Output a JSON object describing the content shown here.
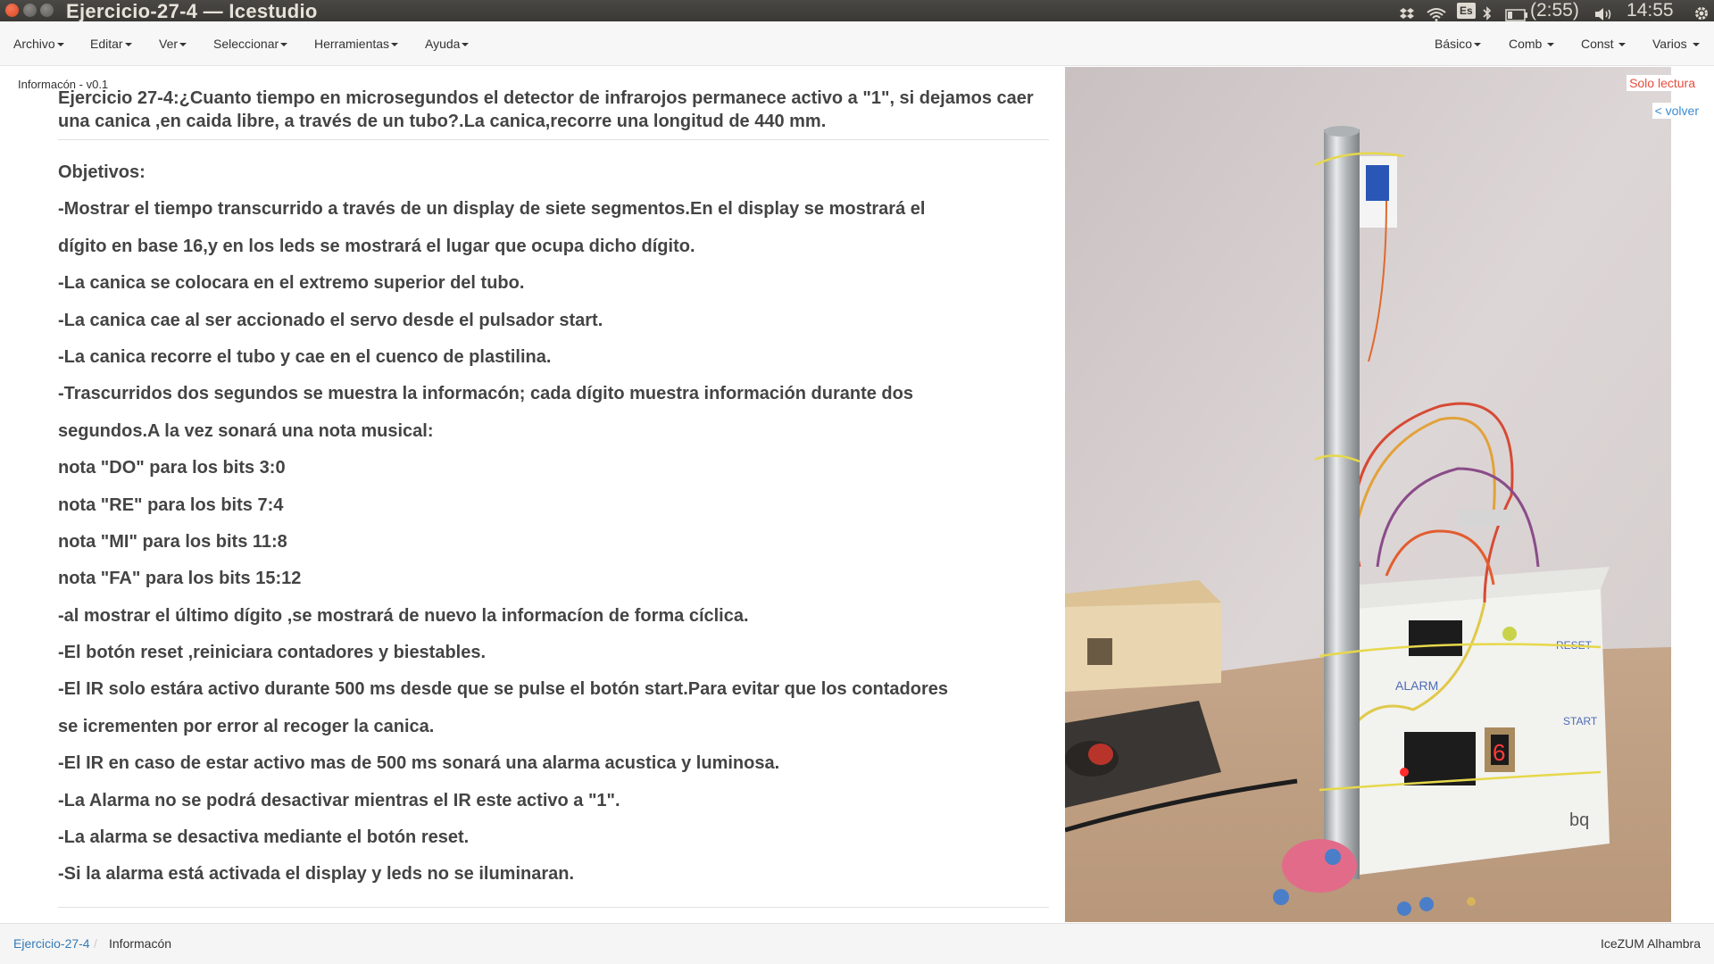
{
  "window": {
    "title": "Ejercicio-27-4 — Icestudio",
    "controls": [
      "close-icon",
      "minimize-icon",
      "maximize-icon"
    ]
  },
  "system_tray": {
    "dropbox_icon": "dropbox-icon",
    "wifi_icon": "wifi-icon",
    "keyboard_layout": "Es",
    "bluetooth_icon": "bluetooth-icon",
    "battery_text": "(2:55)",
    "volume_icon": "volume-icon",
    "clock": "14:55",
    "settings_icon": "gear-icon"
  },
  "menu": {
    "left": [
      "Archivo",
      "Editar",
      "Ver",
      "Seleccionar",
      "Herramientas",
      "Ayuda"
    ],
    "right": [
      "Básico",
      "Comb",
      "Const",
      "Varios"
    ]
  },
  "panel": {
    "label": "Informacón - v0.1",
    "readonly": "Solo lectura",
    "back": "< volver"
  },
  "document": {
    "title": "Ejercicio 27-4:¿Cuanto tiempo en microsegundos el detector de infrarojos permanece activo a \"1\", si dejamos caer una canica ,en caida libre, a través de un tubo?.La canica,recorre una longitud de 440 mm.",
    "lines": [
      "Objetivos:",
      "-Mostrar el tiempo transcurrido a través de un display de siete segmentos.En el display se mostrará el",
      "dígito en base 16,y en los leds se mostrará el lugar que ocupa dicho dígito.",
      "-La canica se colocara en el extremo superior del tubo.",
      "-La canica cae al ser accionado el servo desde el pulsador start.",
      "-La canica recorre el tubo y cae en el cuenco de plastilina.",
      "-Trascurridos dos segundos se muestra la informacón; cada dígito muestra información durante dos",
      "segundos.A la vez sonará una nota musical:",
      "nota \"DO\" para los bits 3:0",
      "nota \"RE\" para los bits 7:4",
      "nota \"MI\" para los bits 11:8",
      "nota \"FA\" para los bits 15:12",
      "-al mostrar el último dígito ,se mostrará de nuevo la informacíon de forma cíclica.",
      "-El botón reset ,reiniciara contadores y biestables.",
      "-El IR solo estára activo durante 500 ms desde que se pulse el botón start.Para evitar que los contadores",
      "se icrementen por error al recoger la canica.",
      "-El IR en caso de estar activo mas de 500 ms sonará una alarma acustica y luminosa.",
      "-La Alarma no se podrá desactivar mientras el IR este activo a \"1\".",
      "-La alarma se desactiva mediante el botón reset.",
      "-Si la alarma está activada el display y leds no se iluminaran."
    ]
  },
  "photo": {
    "board_labels": [
      "ALARM",
      "RESET",
      "START",
      "bq"
    ],
    "display_digit": "6"
  },
  "footer": {
    "breadcrumb": [
      "Ejercicio-27-4",
      "Informacón"
    ],
    "separator": "/",
    "board": "IceZUM Alhambra"
  },
  "colors": {
    "accent_red": "#e74c3c",
    "link_blue": "#3b8bd0",
    "text": "#444444"
  }
}
